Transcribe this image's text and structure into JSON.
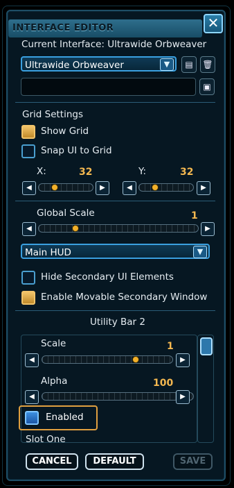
{
  "window": {
    "title": "INTERFACE EDITOR",
    "close_glyph": "✕"
  },
  "current_interface": {
    "label": "Current Interface: Ultrawide Orbweaver",
    "selected": "Ultrawide Orbweaver",
    "name_value": ""
  },
  "grid": {
    "heading": "Grid Settings",
    "show_grid_label": "Show Grid",
    "show_grid_checked": true,
    "snap_label": "Snap UI to Grid",
    "snap_checked": false,
    "x_label": "X:",
    "x_value": "32",
    "x_level": 0.2,
    "y_label": "Y:",
    "y_value": "32",
    "y_level": 0.2
  },
  "global_scale": {
    "label": "Global Scale",
    "value": "1",
    "level": 0.2
  },
  "element_select": {
    "selected": "Main HUD"
  },
  "options": {
    "hide_secondary_label": "Hide Secondary UI Elements",
    "hide_secondary_checked": false,
    "movable_secondary_label": "Enable Movable Secondary Window",
    "movable_secondary_checked": true
  },
  "element_section": {
    "heading": "Utility Bar 2",
    "scale_label": "Scale",
    "scale_value": "1",
    "scale_level": 0.75,
    "alpha_label": "Alpha",
    "alpha_value": "100",
    "alpha_level": 1.0,
    "enabled_label": "Enabled",
    "enabled_checked": true,
    "slot_label": "Slot One"
  },
  "buttons": {
    "cancel": "CANCEL",
    "default": "DEFAULT",
    "save": "SAVE"
  },
  "colors": {
    "accent_gold": "#f4b850",
    "frame_blue": "#3aa0e0",
    "highlight_orange": "#e0a040"
  }
}
